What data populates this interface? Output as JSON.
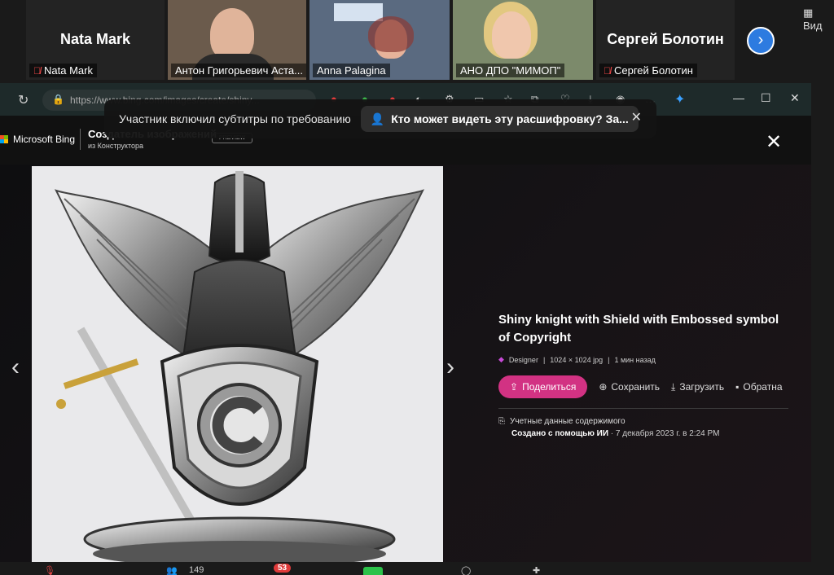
{
  "participants": [
    {
      "big_name": "Nata Mark",
      "label": "Nata Mark",
      "muted": true
    },
    {
      "label": "Антон Григорьевич Аста..."
    },
    {
      "label": "Anna Palagina"
    },
    {
      "label": "АНО ДПО \"МИМОП\""
    },
    {
      "big_name": "Сергей Болотин",
      "label": "Сергей Болотин",
      "muted": true
    }
  ],
  "view_button": "Вид",
  "browser": {
    "url": "https://www.bing.com/images/create/shiny..."
  },
  "captions": {
    "text": "Участник включил субтитры по требованию",
    "pill_text": "Кто может видеть эту расшифровку? За..."
  },
  "bing": {
    "brand": "Microsoft Bing",
    "creator_title": "Создатель изображений",
    "creator_sub": "из Конструктора",
    "preview": "PREVIEW"
  },
  "image_info": {
    "title": "Shiny knight with Shield with Embossed symbol of Copyright",
    "source": "Designer",
    "size": "1024 × 1024 jpg",
    "time": "1 мин назад",
    "share": "Поделиться",
    "save": "Сохранить",
    "download": "Загрузить",
    "feedback": "Обратна",
    "credentials": "Учетные данные содержимого",
    "created_by": "Создано с помощью ИИ",
    "created_date": " · 7 декабря 2023 г. в 2:24 PM"
  },
  "bottom": {
    "participants_count": "149",
    "chat_badge": "53"
  }
}
